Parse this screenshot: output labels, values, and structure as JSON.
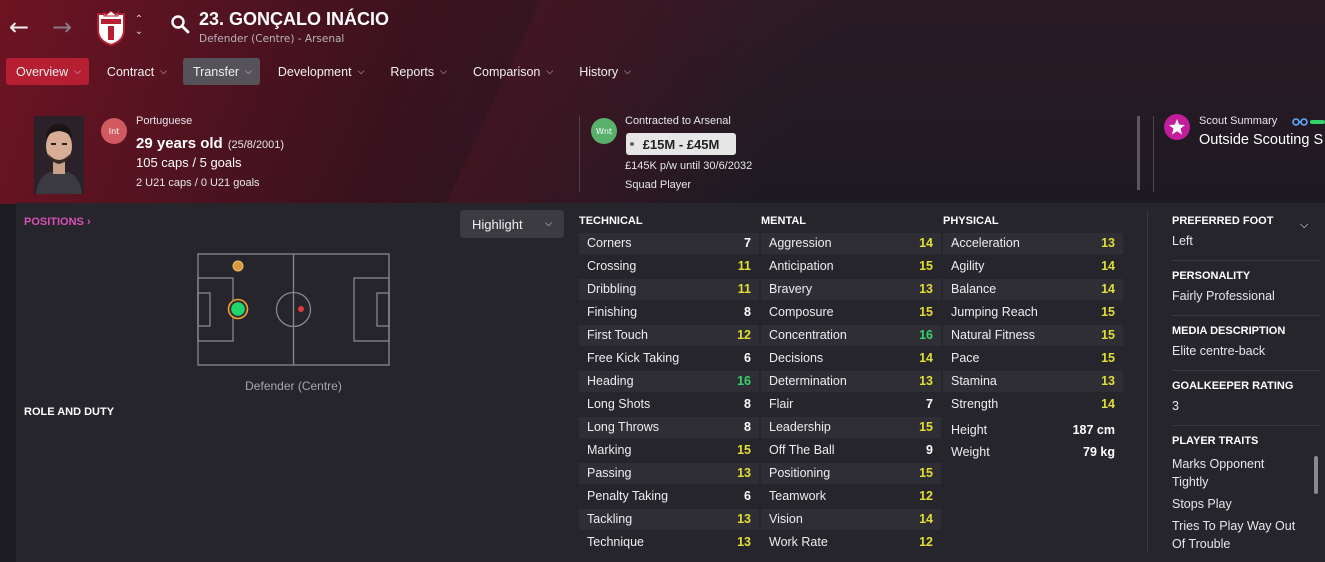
{
  "header": {
    "back_icon": "arrow-left-icon",
    "forward_icon": "arrow-right-icon",
    "player_name": "23. GONÇALO INÁCIO",
    "player_subtitle": "Defender (Centre) - Arsenal"
  },
  "tabs": [
    {
      "label": "Overview",
      "state": "active"
    },
    {
      "label": "Contract",
      "state": "normal"
    },
    {
      "label": "Transfer",
      "state": "selected"
    },
    {
      "label": "Development",
      "state": "normal"
    },
    {
      "label": "Reports",
      "state": "normal"
    },
    {
      "label": "Comparison",
      "state": "normal"
    },
    {
      "label": "History",
      "state": "normal"
    }
  ],
  "profile": {
    "nationality_badge": "Int",
    "nationality": "Portuguese",
    "age": "29 years old",
    "dob": "(25/8/2001)",
    "caps": "105 caps / 5 goals",
    "u21_caps": "2 U21 caps / 0 U21 goals"
  },
  "contract": {
    "badge": "Wnt",
    "contracted_to": "Contracted to Arsenal",
    "value": "£15M - £45M",
    "wage": "£145K p/w until 30/6/2032",
    "status": "Squad Player"
  },
  "scout": {
    "label": "Scout Summary",
    "value": "Outside Scouting S"
  },
  "positions": {
    "title": "POSITIONS",
    "highlight_label": "Highlight",
    "caption": "Defender (Centre)",
    "role_title": "ROLE AND DUTY"
  },
  "attributes": {
    "technical": {
      "title": "TECHNICAL",
      "rows": [
        {
          "name": "Corners",
          "value": "7"
        },
        {
          "name": "Crossing",
          "value": "11"
        },
        {
          "name": "Dribbling",
          "value": "11"
        },
        {
          "name": "Finishing",
          "value": "8"
        },
        {
          "name": "First Touch",
          "value": "12"
        },
        {
          "name": "Free Kick Taking",
          "value": "6"
        },
        {
          "name": "Heading",
          "value": "16"
        },
        {
          "name": "Long Shots",
          "value": "8"
        },
        {
          "name": "Long Throws",
          "value": "8"
        },
        {
          "name": "Marking",
          "value": "15"
        },
        {
          "name": "Passing",
          "value": "13"
        },
        {
          "name": "Penalty Taking",
          "value": "6"
        },
        {
          "name": "Tackling",
          "value": "13"
        },
        {
          "name": "Technique",
          "value": "13"
        }
      ]
    },
    "mental": {
      "title": "MENTAL",
      "rows": [
        {
          "name": "Aggression",
          "value": "14"
        },
        {
          "name": "Anticipation",
          "value": "15"
        },
        {
          "name": "Bravery",
          "value": "13"
        },
        {
          "name": "Composure",
          "value": "15"
        },
        {
          "name": "Concentration",
          "value": "16"
        },
        {
          "name": "Decisions",
          "value": "14"
        },
        {
          "name": "Determination",
          "value": "13"
        },
        {
          "name": "Flair",
          "value": "7"
        },
        {
          "name": "Leadership",
          "value": "15"
        },
        {
          "name": "Off The Ball",
          "value": "9"
        },
        {
          "name": "Positioning",
          "value": "15"
        },
        {
          "name": "Teamwork",
          "value": "12"
        },
        {
          "name": "Vision",
          "value": "14"
        },
        {
          "name": "Work Rate",
          "value": "12"
        }
      ]
    },
    "physical": {
      "title": "PHYSICAL",
      "rows": [
        {
          "name": "Acceleration",
          "value": "13"
        },
        {
          "name": "Agility",
          "value": "14"
        },
        {
          "name": "Balance",
          "value": "14"
        },
        {
          "name": "Jumping Reach",
          "value": "15"
        },
        {
          "name": "Natural Fitness",
          "value": "15"
        },
        {
          "name": "Pace",
          "value": "15"
        },
        {
          "name": "Stamina",
          "value": "13"
        },
        {
          "name": "Strength",
          "value": "14"
        }
      ],
      "height_label": "Height",
      "height_value": "187 cm",
      "weight_label": "Weight",
      "weight_value": "79 kg"
    }
  },
  "info": {
    "preferred_foot_label": "PREFERRED FOOT",
    "preferred_foot": "Left",
    "personality_label": "PERSONALITY",
    "personality": "Fairly Professional",
    "media_label": "MEDIA DESCRIPTION",
    "media": "Elite centre-back",
    "gk_rating_label": "GOALKEEPER RATING",
    "gk_rating": "3",
    "traits_label": "PLAYER TRAITS",
    "traits": [
      "Marks Opponent",
      "Tightly",
      "Stops Play",
      "Tries To Play Way Out",
      "Of Trouble"
    ]
  },
  "colors": {
    "accent": "#b61e32",
    "attr_white": "#ffffff",
    "attr_yellow": "#e2de34",
    "attr_green": "#34d36a",
    "positions_pink": "#d94fb8"
  }
}
